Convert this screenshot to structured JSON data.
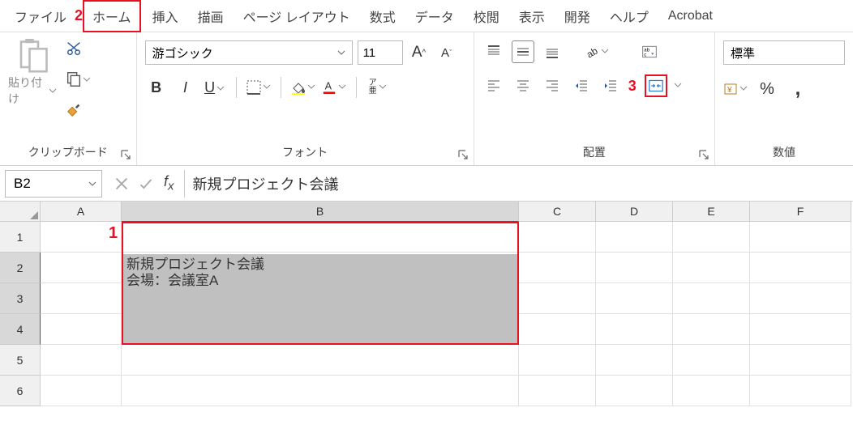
{
  "menu": {
    "file": "ファイル",
    "callout2": "2",
    "home": "ホーム",
    "insert": "挿入",
    "draw": "描画",
    "layout": "ページ レイアウト",
    "formula": "数式",
    "data": "データ",
    "review": "校閲",
    "view": "表示",
    "developer": "開発",
    "help": "ヘルプ",
    "acrobat": "Acrobat"
  },
  "ribbon": {
    "clipboard": {
      "paste": "貼り付け",
      "label": "クリップボード"
    },
    "font": {
      "name": "游ゴシック",
      "size": "11",
      "bold": "B",
      "italic": "I",
      "underline": "U",
      "phonetic": "ア\n亜",
      "label": "フォント"
    },
    "number_format": "標準",
    "align": {
      "label": "配置",
      "callout3": "3"
    },
    "number": {
      "label": "数値"
    }
  },
  "namebox": "B2",
  "formula": "新規プロジェクト会議",
  "callout1": "1",
  "cols": {
    "A": "A",
    "B": "B",
    "C": "C",
    "D": "D",
    "E": "E",
    "F": "F"
  },
  "rows": {
    "1": "1",
    "2": "2",
    "3": "3",
    "4": "4",
    "5": "5",
    "6": "6"
  },
  "cell_b2_line1": "新規プロジェクト会議",
  "cell_b2_line2": "会場：会議室A"
}
